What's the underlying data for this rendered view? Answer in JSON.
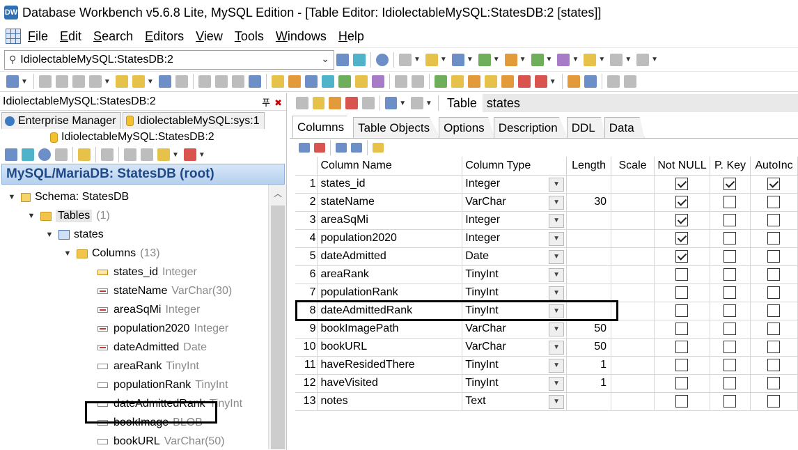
{
  "window": {
    "title": "Database Workbench v5.6.8 Lite, MySQL Edition - [Table Editor: IdiolectableMySQL:StatesDB:2 [states]]",
    "app_icon_text": "DW"
  },
  "menu": [
    "File",
    "Edit",
    "Search",
    "Editors",
    "View",
    "Tools",
    "Windows",
    "Help"
  ],
  "connection_combo": {
    "value": "IdiolectableMySQL:StatesDB:2"
  },
  "left_panel": {
    "header": "IdiolectableMySQL:StatesDB:2",
    "header_buttons": {
      "pin": "푸",
      "close": "✖"
    },
    "tabs": [
      "Enterprise Manager",
      "IdiolectableMySQL:sys:1"
    ],
    "tab2": "IdiolectableMySQL:StatesDB:2",
    "banner": "MySQL/MariaDB: StatesDB (root)",
    "tree": {
      "schema": "Schema: StatesDB",
      "tables_label": "Tables",
      "tables_count": "(1)",
      "table_name": "states",
      "columns_label": "Columns",
      "columns_count": "(13)",
      "columns": [
        {
          "name": "states_id",
          "type": "Integer",
          "icon": "key-column-icon"
        },
        {
          "name": "stateName",
          "type": "VarChar(30)",
          "icon": "string-column-icon"
        },
        {
          "name": "areaSqMi",
          "type": "Integer",
          "icon": "string-column-icon"
        },
        {
          "name": "population2020",
          "type": "Integer",
          "icon": "string-column-icon"
        },
        {
          "name": "dateAdmitted",
          "type": "Date",
          "icon": "string-column-icon"
        },
        {
          "name": "areaRank",
          "type": "TinyInt",
          "icon": "column-icon"
        },
        {
          "name": "populationRank",
          "type": "TinyInt",
          "icon": "column-icon"
        },
        {
          "name": "dateAdmittedRank",
          "type": "TinyInt",
          "icon": "column-icon"
        },
        {
          "name": "bookImage",
          "type": "BLOB",
          "icon": "column-icon"
        },
        {
          "name": "bookURL",
          "type": "VarChar(50)",
          "icon": "column-icon"
        }
      ]
    }
  },
  "right_panel": {
    "object_label": "Table",
    "object_name": "states",
    "tabs": [
      "Columns",
      "Table Objects",
      "Options",
      "Description",
      "DDL",
      "Data"
    ],
    "grid": {
      "headers": [
        "",
        "Column Name",
        "Column Type",
        "Length",
        "Scale",
        "Not NULL",
        "P. Key",
        "AutoInc"
      ],
      "rows": [
        {
          "num": "1",
          "name": "states_id",
          "type": "Integer",
          "length": "",
          "scale": "",
          "notnull": true,
          "pkey": true,
          "autoinc": true
        },
        {
          "num": "2",
          "name": "stateName",
          "type": "VarChar",
          "length": "30",
          "scale": "",
          "notnull": true,
          "pkey": false,
          "autoinc": false
        },
        {
          "num": "3",
          "name": "areaSqMi",
          "type": "Integer",
          "length": "",
          "scale": "",
          "notnull": true,
          "pkey": false,
          "autoinc": false
        },
        {
          "num": "4",
          "name": "population2020",
          "type": "Integer",
          "length": "",
          "scale": "",
          "notnull": true,
          "pkey": false,
          "autoinc": false
        },
        {
          "num": "5",
          "name": "dateAdmitted",
          "type": "Date",
          "length": "",
          "scale": "",
          "notnull": true,
          "pkey": false,
          "autoinc": false
        },
        {
          "num": "6",
          "name": "areaRank",
          "type": "TinyInt",
          "length": "",
          "scale": "",
          "notnull": false,
          "pkey": false,
          "autoinc": false
        },
        {
          "num": "7",
          "name": "populationRank",
          "type": "TinyInt",
          "length": "",
          "scale": "",
          "notnull": false,
          "pkey": false,
          "autoinc": false
        },
        {
          "num": "8",
          "name": "dateAdmittedRank",
          "type": "TinyInt",
          "length": "",
          "scale": "",
          "notnull": false,
          "pkey": false,
          "autoinc": false
        },
        {
          "num": "9",
          "name": "bookImagePath",
          "type": "VarChar",
          "length": "50",
          "scale": "",
          "notnull": false,
          "pkey": false,
          "autoinc": false
        },
        {
          "num": "10",
          "name": "bookURL",
          "type": "VarChar",
          "length": "50",
          "scale": "",
          "notnull": false,
          "pkey": false,
          "autoinc": false
        },
        {
          "num": "11",
          "name": "haveResidedThere",
          "type": "TinyInt",
          "length": "1",
          "scale": "",
          "notnull": false,
          "pkey": false,
          "autoinc": false
        },
        {
          "num": "12",
          "name": "haveVisited",
          "type": "TinyInt",
          "length": "1",
          "scale": "",
          "notnull": false,
          "pkey": false,
          "autoinc": false
        },
        {
          "num": "13",
          "name": "notes",
          "type": "Text",
          "length": "",
          "scale": "",
          "notnull": false,
          "pkey": false,
          "autoinc": false
        }
      ]
    }
  }
}
